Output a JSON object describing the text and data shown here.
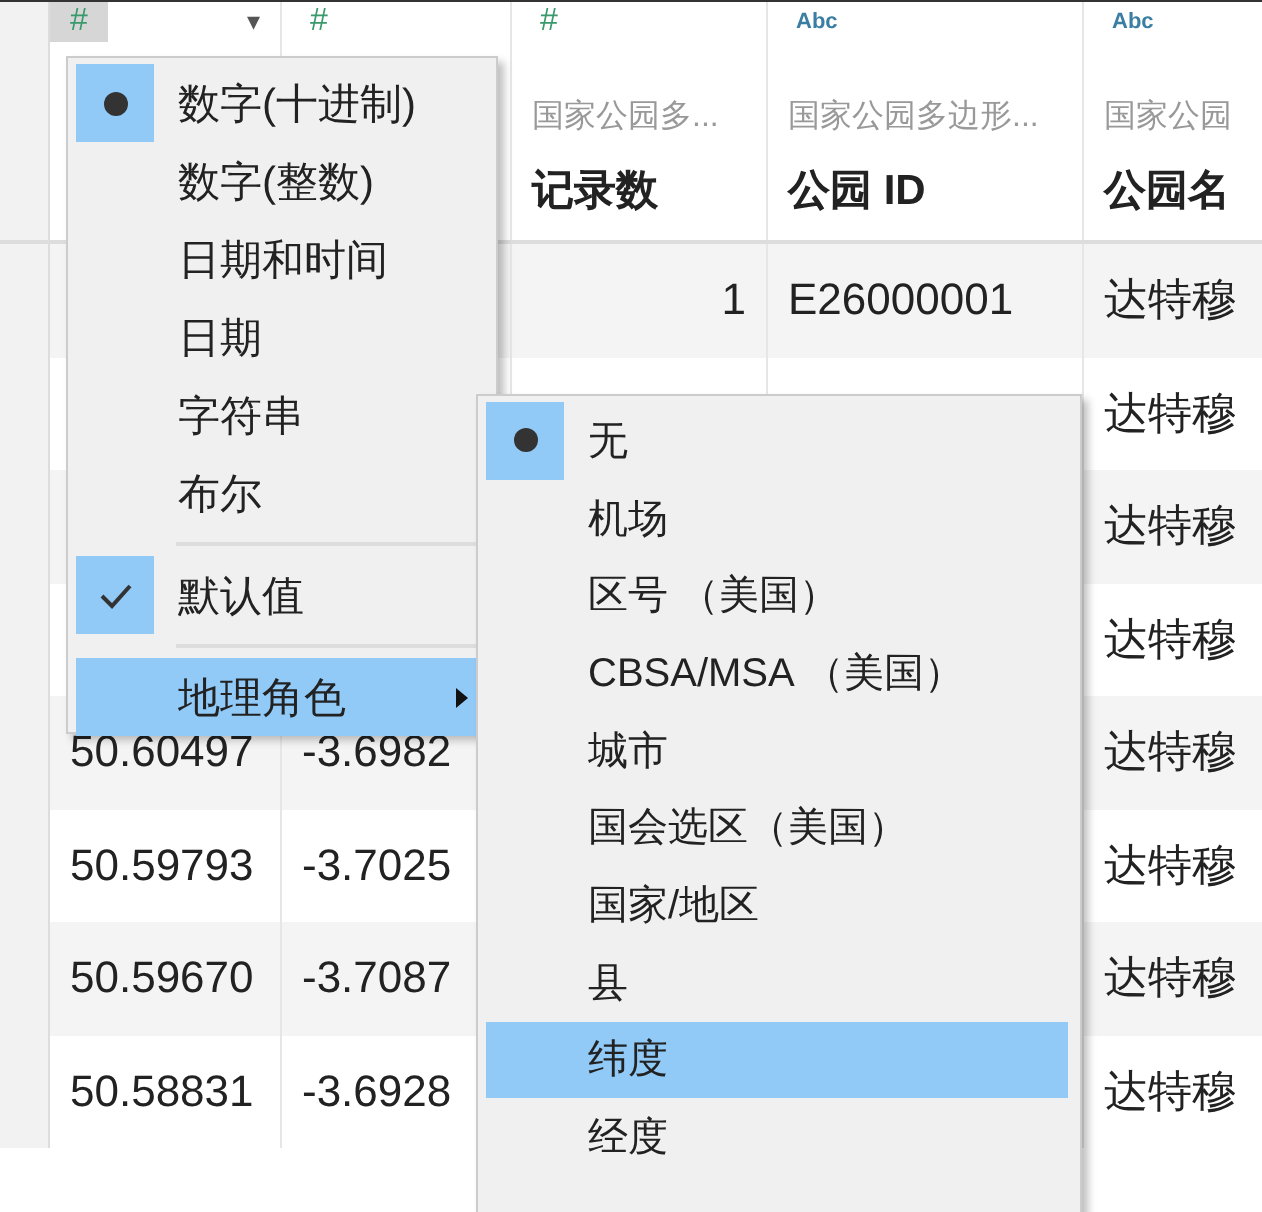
{
  "table": {
    "columns": [
      {
        "type_icon": "#",
        "kind": "number",
        "selected": true,
        "dropdown": "▾"
      },
      {
        "type_icon": "#",
        "kind": "number",
        "selected": false
      },
      {
        "type_icon": "#",
        "kind": "number",
        "selected": false,
        "source": "国家公园多...",
        "title": "记录数"
      },
      {
        "type_icon": "Abc",
        "kind": "text",
        "selected": false,
        "source": "国家公园多边形...",
        "title": "公园 ID"
      },
      {
        "type_icon": "Abc",
        "kind": "text",
        "selected": false,
        "source": "国家公园",
        "title": "公园名"
      }
    ],
    "rows": [
      {
        "cells": [
          null,
          null,
          "1",
          "E26000001",
          "达特穆"
        ]
      },
      {
        "cells": [
          null,
          null,
          null,
          null,
          "达特穆"
        ]
      },
      {
        "cells": [
          null,
          null,
          null,
          null,
          "达特穆"
        ]
      },
      {
        "cells": [
          null,
          null,
          null,
          null,
          "达特穆"
        ]
      },
      {
        "cells": [
          "50.60497",
          "-3.6982",
          null,
          null,
          "达特穆"
        ]
      },
      {
        "cells": [
          "50.59793",
          "-3.7025",
          null,
          null,
          "达特穆"
        ]
      },
      {
        "cells": [
          "50.59670",
          "-3.7087",
          null,
          null,
          "达特穆"
        ]
      },
      {
        "cells": [
          "50.58831",
          "-3.6928",
          null,
          null,
          "达特穆"
        ]
      }
    ]
  },
  "type_menu": {
    "options": [
      {
        "label": "数字(十进制)",
        "selected": true
      },
      {
        "label": "数字(整数)",
        "selected": false
      },
      {
        "label": "日期和时间",
        "selected": false
      },
      {
        "label": "日期",
        "selected": false
      },
      {
        "label": "字符串",
        "selected": false
      },
      {
        "label": "布尔",
        "selected": false
      }
    ],
    "default": {
      "label": "默认值",
      "checked": true
    },
    "geo_role": {
      "label": "地理角色",
      "highlighted": true,
      "expanded": true
    }
  },
  "geo_menu": {
    "items": [
      {
        "label": "无",
        "selected": true,
        "highlighted": false
      },
      {
        "label": "机场",
        "selected": false,
        "highlighted": false
      },
      {
        "label": "区号 （美国）",
        "selected": false,
        "highlighted": false
      },
      {
        "label": "CBSA/MSA （美国）",
        "selected": false,
        "highlighted": false
      },
      {
        "label": "城市",
        "selected": false,
        "highlighted": false
      },
      {
        "label": "国会选区（美国）",
        "selected": false,
        "highlighted": false
      },
      {
        "label": "国家/地区",
        "selected": false,
        "highlighted": false
      },
      {
        "label": "县",
        "selected": false,
        "highlighted": false
      },
      {
        "label": "纬度",
        "selected": false,
        "highlighted": true
      },
      {
        "label": "经度",
        "selected": false,
        "highlighted": false
      }
    ]
  }
}
